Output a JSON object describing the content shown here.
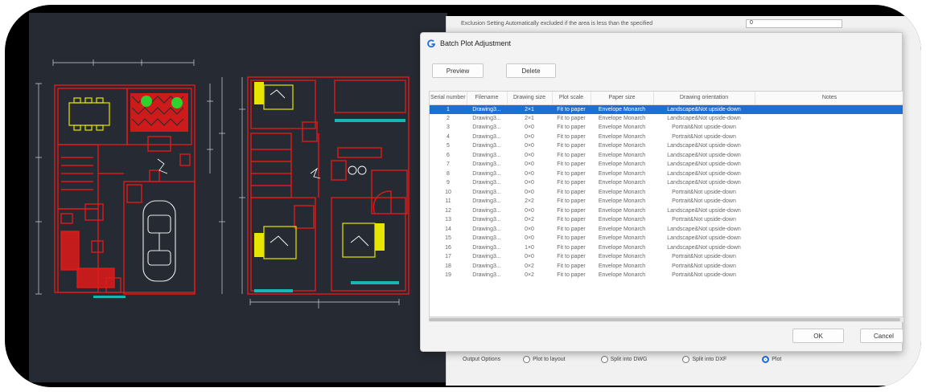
{
  "bg_dialog": {
    "exclusion_label": "Exclusion Setting Automatically excluded if the area is less than the specified",
    "exclusion_value": "0",
    "output_options_label": "Output Options",
    "output_options": [
      {
        "label": "Plot to layout",
        "checked": false
      },
      {
        "label": "Split into DWG",
        "checked": false
      },
      {
        "label": "Split into DXF",
        "checked": false
      },
      {
        "label": "Plot",
        "checked": true
      }
    ]
  },
  "dialog": {
    "title": "Batch Plot Adjustment",
    "preview_label": "Preview",
    "delete_label": "Delete",
    "ok_label": "OK",
    "cancel_label": "Cancel"
  },
  "table": {
    "columns": [
      "Serial number",
      "Filename",
      "Drawing size",
      "Plot scale",
      "Paper size",
      "Drawing orientation",
      "Notes"
    ],
    "rows": [
      [
        "1",
        "Drawing3...",
        "2×1",
        "Fit to paper",
        "Envelope Monarch",
        "Landscape&Not upside-down",
        ""
      ],
      [
        "2",
        "Drawing3...",
        "2×1",
        "Fit to paper",
        "Envelope Monarch",
        "Landscape&Not upside-down",
        ""
      ],
      [
        "3",
        "Drawing3...",
        "0×0",
        "Fit to paper",
        "Envelope Monarch",
        "Portrait&Not upside-down",
        ""
      ],
      [
        "4",
        "Drawing3...",
        "0×0",
        "Fit to paper",
        "Envelope Monarch",
        "Portrait&Not upside-down",
        ""
      ],
      [
        "5",
        "Drawing3...",
        "0×0",
        "Fit to paper",
        "Envelope Monarch",
        "Landscape&Not upside-down",
        ""
      ],
      [
        "6",
        "Drawing3...",
        "0×0",
        "Fit to paper",
        "Envelope Monarch",
        "Landscape&Not upside-down",
        ""
      ],
      [
        "7",
        "Drawing3...",
        "0×0",
        "Fit to paper",
        "Envelope Monarch",
        "Landscape&Not upside-down",
        ""
      ],
      [
        "8",
        "Drawing3...",
        "0×0",
        "Fit to paper",
        "Envelope Monarch",
        "Landscape&Not upside-down",
        ""
      ],
      [
        "9",
        "Drawing3...",
        "0×0",
        "Fit to paper",
        "Envelope Monarch",
        "Landscape&Not upside-down",
        ""
      ],
      [
        "10",
        "Drawing3...",
        "0×0",
        "Fit to paper",
        "Envelope Monarch",
        "Portrait&Not upside-down",
        ""
      ],
      [
        "11",
        "Drawing3...",
        "2×2",
        "Fit to paper",
        "Envelope Monarch",
        "Portrait&Not upside-down",
        ""
      ],
      [
        "12",
        "Drawing3...",
        "0×0",
        "Fit to paper",
        "Envelope Monarch",
        "Landscape&Not upside-down",
        ""
      ],
      [
        "13",
        "Drawing3...",
        "0×2",
        "Fit to paper",
        "Envelope Monarch",
        "Portrait&Not upside-down",
        ""
      ],
      [
        "14",
        "Drawing3...",
        "0×0",
        "Fit to paper",
        "Envelope Monarch",
        "Landscape&Not upside-down",
        ""
      ],
      [
        "15",
        "Drawing3...",
        "0×0",
        "Fit to paper",
        "Envelope Monarch",
        "Landscape&Not upside-down",
        ""
      ],
      [
        "16",
        "Drawing3...",
        "1×0",
        "Fit to paper",
        "Envelope Monarch",
        "Landscape&Not upside-down",
        ""
      ],
      [
        "17",
        "Drawing3...",
        "0×0",
        "Fit to paper",
        "Envelope Monarch",
        "Portrait&Not upside-down",
        ""
      ],
      [
        "18",
        "Drawing3...",
        "0×2",
        "Fit to paper",
        "Envelope Monarch",
        "Portrait&Not upside-down",
        ""
      ],
      [
        "19",
        "Drawing3...",
        "0×2",
        "Fit to paper",
        "Envelope Monarch",
        "Portrait&Not upside-down",
        ""
      ]
    ],
    "selected_row": 0
  },
  "colors": {
    "cad_background": "#262b33",
    "selection": "#1c6fd4",
    "wall": "#e01a1a",
    "furniture": "#e6e600",
    "accent": "#19b4b4"
  }
}
